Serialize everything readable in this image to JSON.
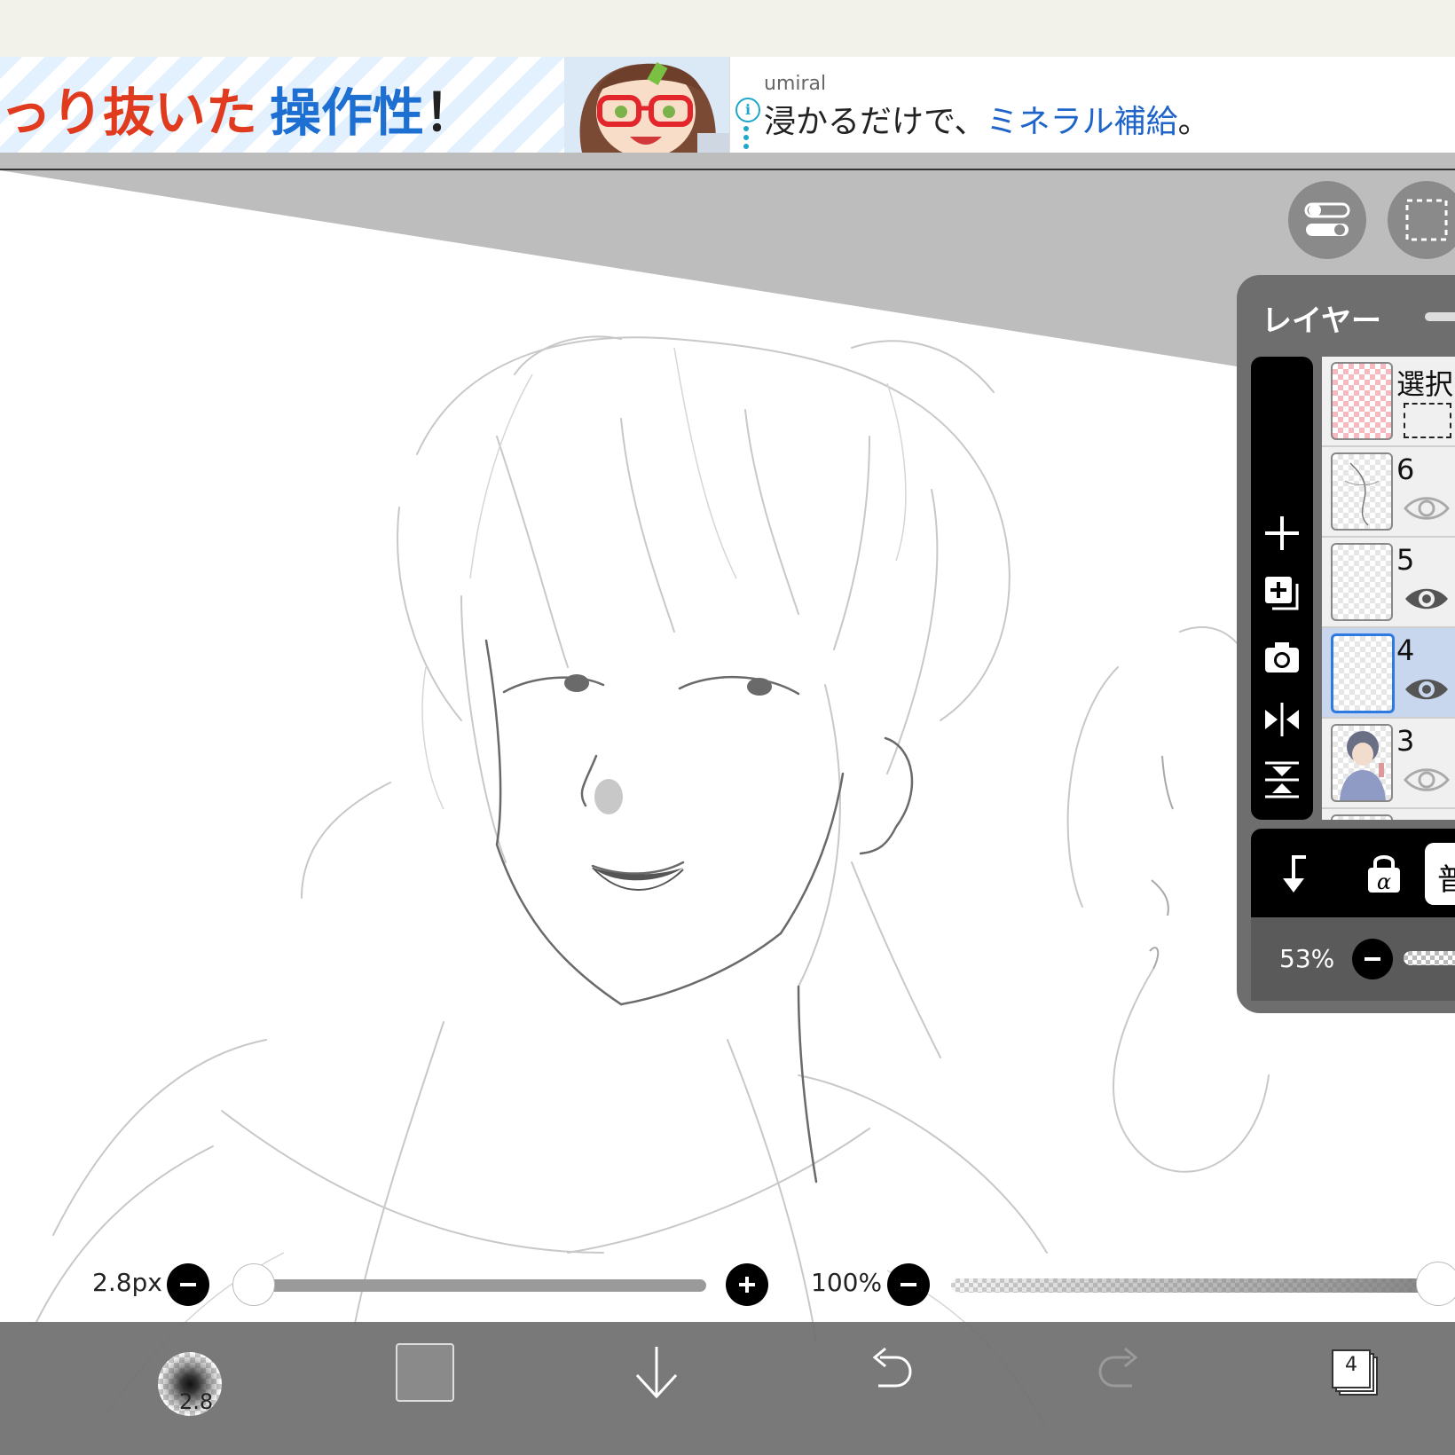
{
  "ad": {
    "headline_red": "っり抜いた",
    "headline_blue": "操作性",
    "headline_mark": "！",
    "sponsor": "umiral",
    "text_prefix": "浸かるだけで、",
    "text_highlight": "ミネラル補給",
    "text_suffix": "。",
    "info_glyph": "i"
  },
  "layer_panel": {
    "title": "レイヤー",
    "layers": [
      {
        "name": "選択",
        "kind": "selection",
        "visible": null,
        "selected": false
      },
      {
        "name": "6",
        "kind": "sketch",
        "visible": false,
        "selected": false
      },
      {
        "name": "5",
        "kind": "sketch",
        "visible": true,
        "selected": false
      },
      {
        "name": "4",
        "kind": "empty",
        "visible": true,
        "selected": true
      },
      {
        "name": "3",
        "kind": "colored",
        "visible": false,
        "selected": false
      }
    ],
    "tools": [
      "add-layer-icon",
      "duplicate-layer-icon",
      "camera-icon",
      "flip-horizontal-icon",
      "flip-vertical-icon"
    ],
    "blend_mode_label": "普",
    "opacity_label": "53%",
    "opacity_value": 0.53
  },
  "brush": {
    "size_label": "2.8px",
    "size_fraction": 0.0,
    "opacity_label": "100%",
    "opacity_fraction": 1.0
  },
  "bottom_bar": {
    "brush_size_badge": "2.8",
    "layer_count_badge": "4",
    "icons": [
      "brush-preview-icon",
      "color-swatch",
      "download-icon",
      "undo-icon",
      "redo-icon",
      "layers-icon"
    ]
  },
  "colors": {
    "accent_blue": "#2d7be0",
    "panel_bg": "#6e6e6e",
    "canvas_bg": "#ffffff",
    "ad_red": "#e03b1f",
    "ad_blue": "#1d6fd1"
  }
}
